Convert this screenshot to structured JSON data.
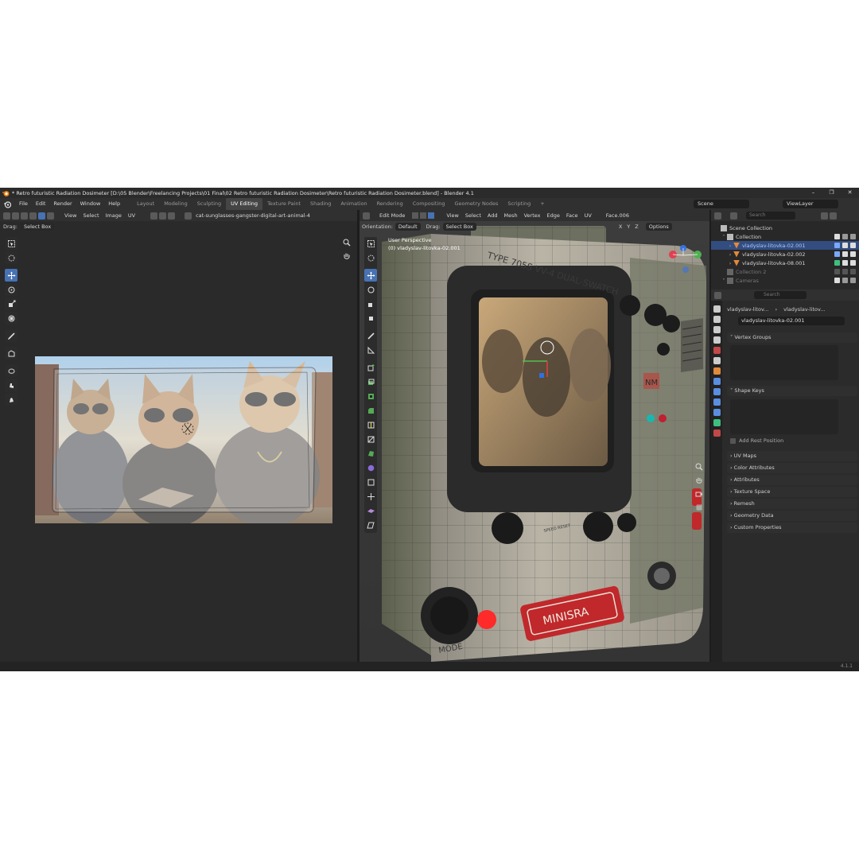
{
  "window": {
    "title": "* Retro futuristic Radiation Dosimeter [D:\\05 Blender\\Freelancing Projects\\01 Final\\02 Retro futuristic Radiation Dosimeter\\Retro futuristic Radiation Dosimeter.blend] - Blender 4.1",
    "controls": [
      "–",
      "❐",
      "✕"
    ]
  },
  "menu": {
    "items": [
      "File",
      "Edit",
      "Render",
      "Window",
      "Help"
    ],
    "workspaces": [
      "Layout",
      "Modeling",
      "Sculpting",
      "UV Editing",
      "Texture Paint",
      "Shading",
      "Animation",
      "Rendering",
      "Compositing",
      "Geometry Nodes",
      "Scripting"
    ],
    "active_workspace": "UV Editing",
    "add_tab": "+",
    "scene": "Scene",
    "view_layer": "ViewLayer"
  },
  "uv_editor": {
    "menus": [
      "View",
      "Select",
      "Image",
      "UV"
    ],
    "image_name": "cat-sunglasses-gangster-digital-art-animal-4",
    "drag_label": "Drag:",
    "drag_value": "Select Box"
  },
  "viewport": {
    "mode": "Edit Mode",
    "menus": [
      "View",
      "Select",
      "Add",
      "Mesh",
      "Vertex",
      "Edge",
      "Face",
      "UV"
    ],
    "active_face": "Face.006",
    "orientation_label": "Orientation:",
    "orientation_value": "Default",
    "drag_label": "Drag:",
    "drag_value": "Select Box",
    "axes": [
      "X",
      "Y",
      "Z"
    ],
    "options": "Options",
    "info_line1": "User Perspective",
    "info_line2": "(0) vladyslav-litovka-02.001",
    "device_text_top": "TYPE 705S VV-4 DUAL-SWATCH",
    "device_brand": "MINISRA",
    "device_mode": "MODE",
    "device_badge": "NM",
    "device_label_small": "SPEED RESET"
  },
  "outliner": {
    "search_placeholder": "Search",
    "root": "Scene Collection",
    "collection": "Collection",
    "items": [
      "vladyslav-litovka-02.001",
      "vladyslav-litovka-02.002",
      "vladyslav-litovka-08.001"
    ],
    "collection2": "Collection 2",
    "cameras": "Cameras"
  },
  "properties": {
    "search_placeholder": "Search",
    "breadcrumb_object": "vladyslav-litov...",
    "breadcrumb_mesh": "vladyslav-litov...",
    "mesh_name": "vladyslav-litovka-02.001",
    "sections": {
      "vertex_groups": "Vertex Groups",
      "shape_keys": "Shape Keys",
      "add_rest_position": "Add Rest Position",
      "uv_maps": "UV Maps",
      "color_attributes": "Color Attributes",
      "attributes": "Attributes",
      "texture_space": "Texture Space",
      "remesh": "Remesh",
      "geometry_data": "Geometry Data",
      "custom_properties": "Custom Properties"
    }
  },
  "status": {
    "version": "4.1.1"
  },
  "colors": {
    "accent_blue": "#4772b3",
    "selection": "#334d80",
    "device_red": "#c0282b",
    "orange_icon": "#e08a3c"
  }
}
